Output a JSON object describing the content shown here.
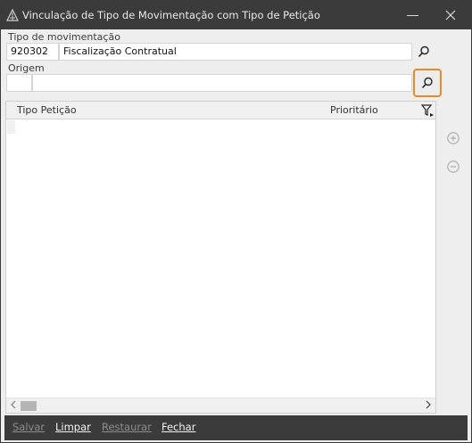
{
  "window": {
    "title": "Vinculação de Tipo de Movimentação com Tipo de Petição"
  },
  "form": {
    "tipo_movimentacao_label": "Tipo de movimentação",
    "tipo_movimentacao_code": "920302",
    "tipo_movimentacao_desc": "Fiscalização Contratual",
    "origem_label": "Origem",
    "origem_code": "",
    "origem_desc": ""
  },
  "grid": {
    "columns": [
      "Tipo Petição",
      "Prioritário"
    ],
    "rows": []
  },
  "footer": {
    "salvar": "Salvar",
    "limpar": "Limpar",
    "restaurar": "Restaurar",
    "fechar": "Fechar"
  },
  "icons": {
    "app": "app-logo-icon",
    "search": "search-icon",
    "filter": "filter-icon",
    "add": "add-circle-icon",
    "remove": "remove-circle-icon"
  },
  "colors": {
    "titlebar": "#3b3b3b",
    "focus_outline": "#e8892a",
    "footer": "#3b3b3b"
  }
}
